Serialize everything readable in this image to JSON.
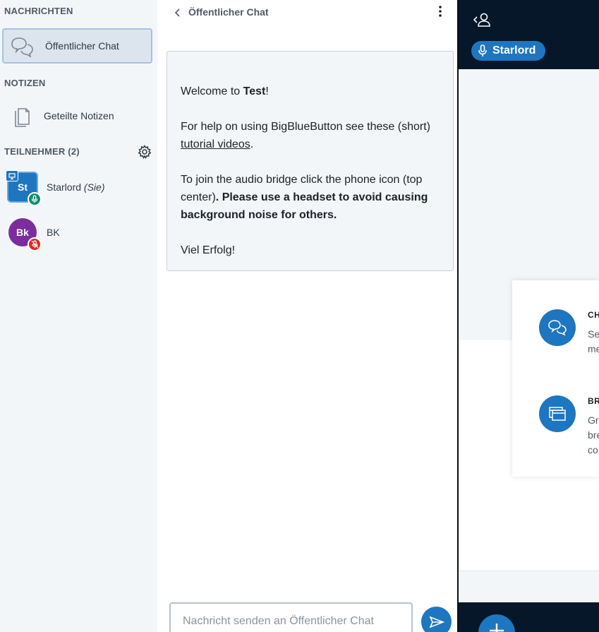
{
  "userlist": {
    "messages_title": "NACHRICHTEN",
    "public_chat_label": "Öffentlicher Chat",
    "notes_title": "NOTIZEN",
    "shared_notes_label": "Geteilte Notizen",
    "participants_title": "TEILNEHMER (2)",
    "users": [
      {
        "initials": "St",
        "name": "Starlord",
        "suffix": "(Sie)",
        "color": "#1e76c0"
      },
      {
        "initials": "Bk",
        "name": "BK",
        "suffix": "",
        "color": "#7b2d9e"
      }
    ]
  },
  "chat": {
    "title": "Öffentlicher Chat",
    "welcome_line1_prefix": "Welcome to ",
    "welcome_line1_name": "Test",
    "welcome_line1_suffix": "!",
    "help_prefix": "For help on using BigBlueButton see these (short) ",
    "help_link": "tutorial videos",
    "help_suffix": ".",
    "audio_prefix": "To join the audio bridge click the phone icon (top center)",
    "audio_bold": ". Please use a headset to avoid causing background noise for others.",
    "closing": "Viel Erfolg!",
    "input_placeholder": "Nachricht senden an Öffentlicher Chat"
  },
  "presentation": {
    "talker_name": "Starlord",
    "cards": [
      {
        "head": "CH",
        "lines": [
          "Se",
          "me"
        ]
      },
      {
        "head": "BR",
        "lines": [
          "Gr",
          "bre",
          "co"
        ]
      }
    ]
  },
  "colors": {
    "accent": "#1e76c0",
    "sidebar_bg": "#f3f6f9",
    "presentation_bg": "#06172a",
    "mic_on": "#0e8f6f",
    "mic_muted": "#df2721"
  }
}
